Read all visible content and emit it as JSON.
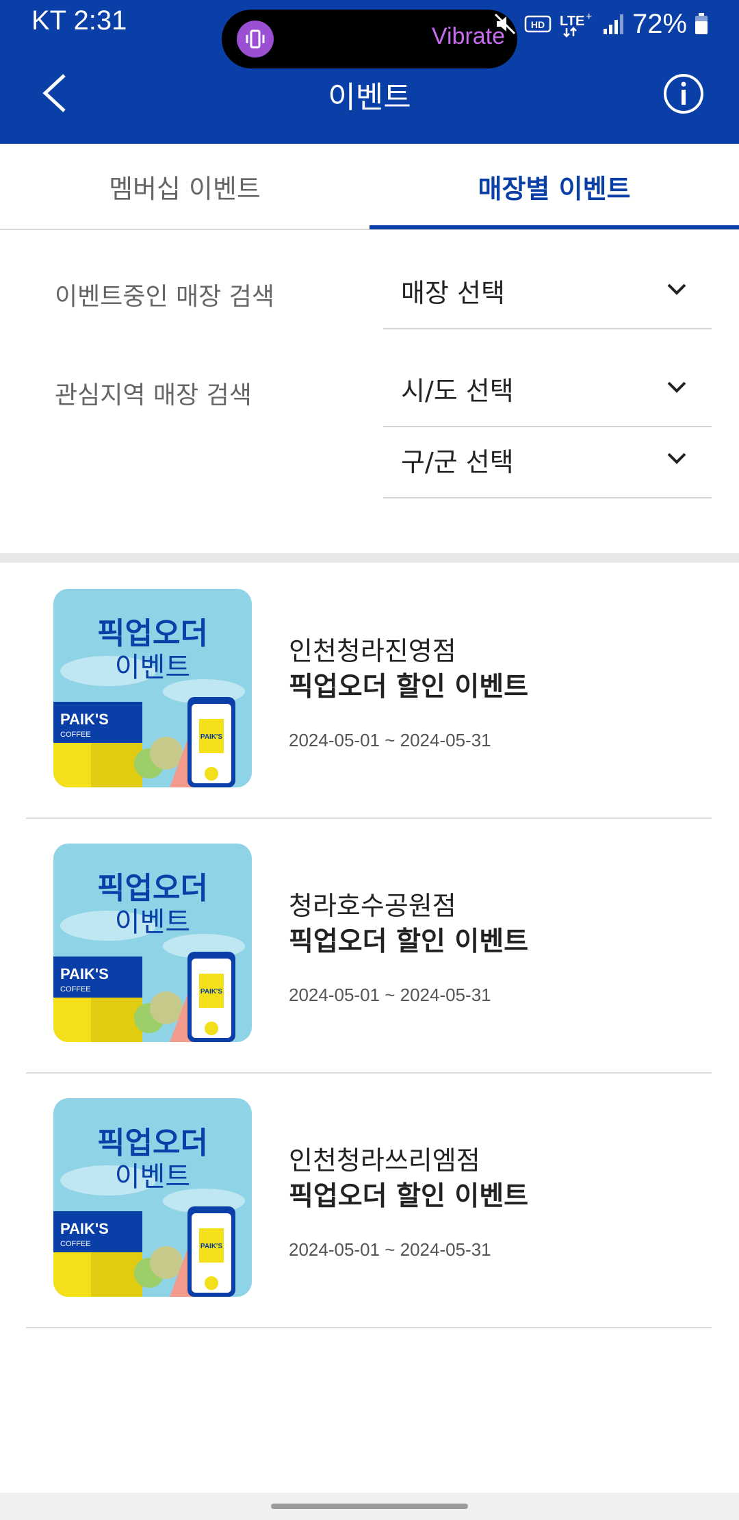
{
  "status_bar": {
    "carrier_time": "KT 2:31",
    "vibrate_label": "Vibrate",
    "battery": "72%"
  },
  "header": {
    "title": "이벤트"
  },
  "tabs": [
    {
      "label": "멤버십 이벤트",
      "active": false
    },
    {
      "label": "매장별 이벤트",
      "active": true
    }
  ],
  "filters": {
    "event_store_label": "이벤트중인 매장 검색",
    "store_select": "매장 선택",
    "region_label": "관심지역 매장 검색",
    "city_select": "시/도 선택",
    "district_select": "구/군 선택"
  },
  "thumbnail": {
    "headline_line1": "픽업오더",
    "headline_line2": "이벤트",
    "brand": "PAIK'S",
    "brand_sub": "COFFEE",
    "cup_brand": "PAIK'S"
  },
  "events": [
    {
      "store": "인천청라진영점",
      "title": "픽업오더 할인 이벤트",
      "date": "2024-05-01 ~ 2024-05-31"
    },
    {
      "store": "청라호수공원점",
      "title": "픽업오더 할인 이벤트",
      "date": "2024-05-01 ~ 2024-05-31"
    },
    {
      "store": "인천청라쓰리엠점",
      "title": "픽업오더 할인 이벤트",
      "date": "2024-05-01 ~ 2024-05-31"
    }
  ],
  "colors": {
    "primary": "#0a3fa8",
    "thumb_sky": "#7ccbe0",
    "thumb_yellow": "#f4e01a"
  }
}
